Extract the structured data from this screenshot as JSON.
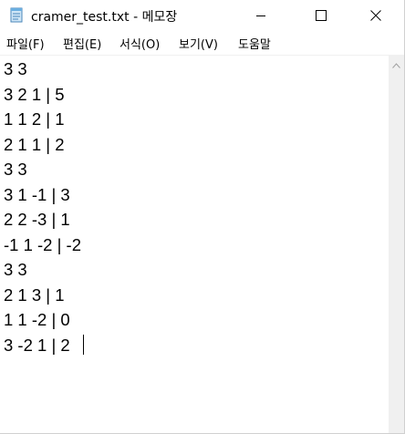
{
  "window": {
    "title": "cramer_test.txt - 메모장",
    "icon": "notepad-icon"
  },
  "caption_buttons": {
    "minimize_icon": "minimize-icon",
    "maximize_icon": "maximize-icon",
    "close_icon": "close-icon"
  },
  "menu": {
    "items": [
      {
        "label": "파일(F)"
      },
      {
        "label": "편집(E)"
      },
      {
        "label": "서식(O)"
      },
      {
        "label": "보기(V)"
      },
      {
        "label": "도움말"
      }
    ]
  },
  "editor": {
    "lines": [
      "3 3",
      "3 2 1 | 5",
      "1 1 2 | 1",
      "2 1 1 | 2",
      "3 3",
      "3 1 -1 | 3",
      "2 2 -3 | 1",
      "-1 1 -2 | -2",
      "3 3",
      "2 1 3 | 1",
      "1 1 -2 | 0",
      "3 -2 1 | 2"
    ]
  },
  "scrollbar": {
    "up_arrow_icon": "chevron-up-icon"
  },
  "colors": {
    "background": "#ffffff",
    "text": "#000000",
    "scroll_track": "#f0f0f0"
  }
}
